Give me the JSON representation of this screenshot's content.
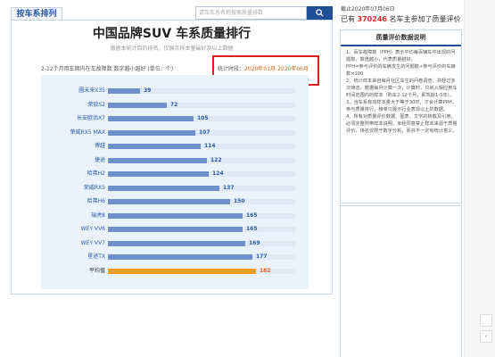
{
  "tab": {
    "label": "按车系排列"
  },
  "search": {
    "placeholder": "请车车系名称搜索质量排数"
  },
  "main": {
    "title": "中国品牌SUV 车系质量排行",
    "subtitle": "根据本统计目的排名，仅展示样本量最好及以上数据",
    "note_left": "2-12个月用车期内在车故障数 数字越小越好 (单位：个)",
    "note_right_prefix": "统计时段：",
    "note_right_date": "2020年01月-2020年06月"
  },
  "chart_data": {
    "type": "bar",
    "categories": [
      "圆未来X35",
      "荣放S2",
      "长安欧尚X7",
      "荣威RX5 MAX",
      "博越",
      "捷途",
      "哈弗H2",
      "荣威RX5",
      "哈弗H6",
      "瑞虎8",
      "WEY VV6",
      "WEY VV7",
      "星途TX",
      "平均值"
    ],
    "values": [
      39,
      72,
      105,
      107,
      114,
      122,
      124,
      137,
      150,
      165,
      165,
      169,
      177,
      182
    ],
    "highlight_category": "平均值",
    "colors": {
      "bar": "#6f8fc9",
      "average": "#f39c23",
      "track": "#dfe9f5"
    }
  },
  "sidebar": {
    "date": "截止2020年07月06日",
    "count_prefix": "已有",
    "count_value": "370246",
    "count_suffix": "名车主参加了质量评价",
    "info_title": "质量评价数据说明",
    "info_paragraphs": [
      "1、百车故障数（PPH）表示平均每百辆车中出现的问题数，数值越小，代表质量越好。",
      "PPH=参与评价的车辆发生的问题数÷参与评价的车辆数×100",
      "2、统计样本来自每月社区车主的问卷调查，并经过多次筛选，数据每月计算一次，计算时，只纳入相应用车时间范围内的样本（购车2-12个月，即驾龄1-5年）。",
      "3、当车系有效样本量大于等于30时，才会计算PPH，参与质量排行，榜单只展示行业表现以上的数据。",
      "4、所有对质量评价数据、图表、文字的转载及引用，必须完整附带样本说明，未经同意禁止样本来源于质量评价，排名仅限于数字分析，而并不一定有统计意义。"
    ]
  },
  "search_button": {
    "icon": "search-icon"
  },
  "side_tools": {
    "arrow": "‹"
  }
}
